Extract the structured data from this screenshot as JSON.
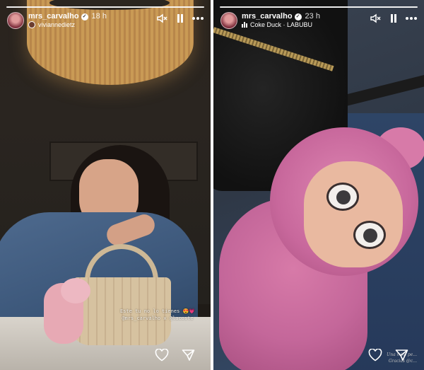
{
  "stories": [
    {
      "username": "mrs_carvalho",
      "time": "18 h",
      "subline_text": "viviannedietz",
      "caption_lines": [
        "Este tu no lo tienes 😍💗",
        "@mrs_carvalho x @lacoste"
      ],
      "icons": {
        "mute": "speaker-muted-icon",
        "pause": "pause-icon",
        "more": "more-dots-icon",
        "like": "heart-icon",
        "share": "send-icon"
      }
    },
    {
      "username": "mrs_carvalho",
      "time": "23 h",
      "music_text": "Coke Duck · LABUBU",
      "watermark_lines": [
        "Una mini pe...",
        "Gracias @c..."
      ],
      "icons": {
        "mute": "speaker-muted-icon",
        "pause": "pause-icon",
        "more": "more-dots-icon",
        "like": "heart-icon",
        "share": "send-icon"
      }
    }
  ],
  "colors": {
    "overlay_text": "#ffffff",
    "lamp": "#c99a55",
    "denim": "#4e6a8e",
    "toy_pink": "#d77aa8",
    "bag_black": "#111111"
  }
}
